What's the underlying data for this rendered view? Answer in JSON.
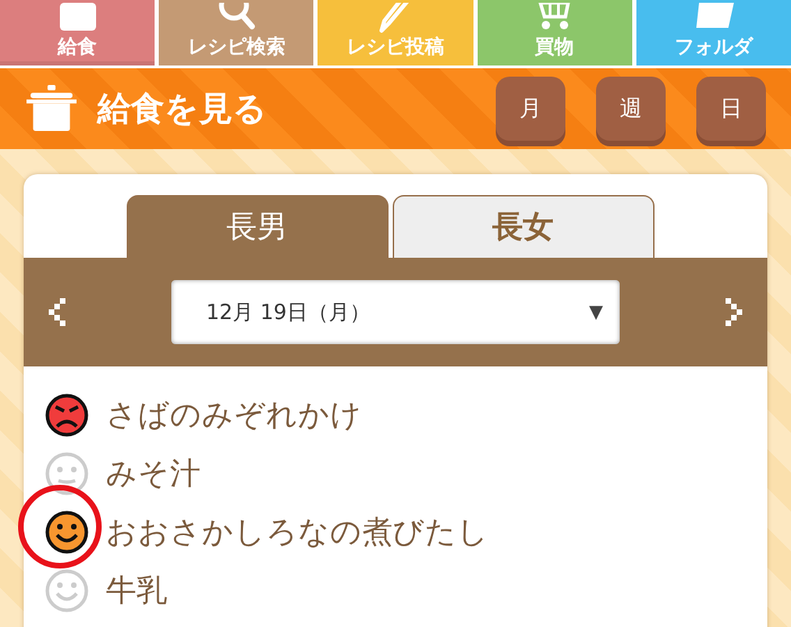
{
  "nav": [
    {
      "label": "給食",
      "color": "#dc7e7e",
      "kind": "box",
      "selected": true
    },
    {
      "label": "レシピ検索",
      "color": "#c49a74",
      "kind": "search",
      "selected": false
    },
    {
      "label": "レシピ投稿",
      "color": "#f6bf3c",
      "kind": "pencil",
      "selected": false
    },
    {
      "label": "買物",
      "color": "#8cc66a",
      "kind": "cart",
      "selected": false
    },
    {
      "label": "フォルダ",
      "color": "#48bdee",
      "kind": "folder",
      "selected": false
    }
  ],
  "header": {
    "title": "給食を見る",
    "views": [
      {
        "label": "月"
      },
      {
        "label": "週"
      },
      {
        "label": "日"
      }
    ]
  },
  "tabs": [
    {
      "label": "長男",
      "selected": true
    },
    {
      "label": "長女",
      "selected": false
    }
  ],
  "date_select": {
    "value": "12月 19日（月）",
    "arrow": "▼"
  },
  "items": [
    {
      "name": "さばのみぞれかけ",
      "kind": "angry",
      "color": "#f03c3c",
      "highlighted": false
    },
    {
      "name": "みそ汁",
      "kind": "neutral",
      "color": "#cccccc",
      "highlighted": false
    },
    {
      "name": "おおさかしろなの煮びたし",
      "kind": "smile",
      "color": "#f7962f",
      "highlighted": true
    },
    {
      "name": "牛乳",
      "kind": "smile",
      "color": "#cccccc",
      "highlighted": false
    }
  ]
}
